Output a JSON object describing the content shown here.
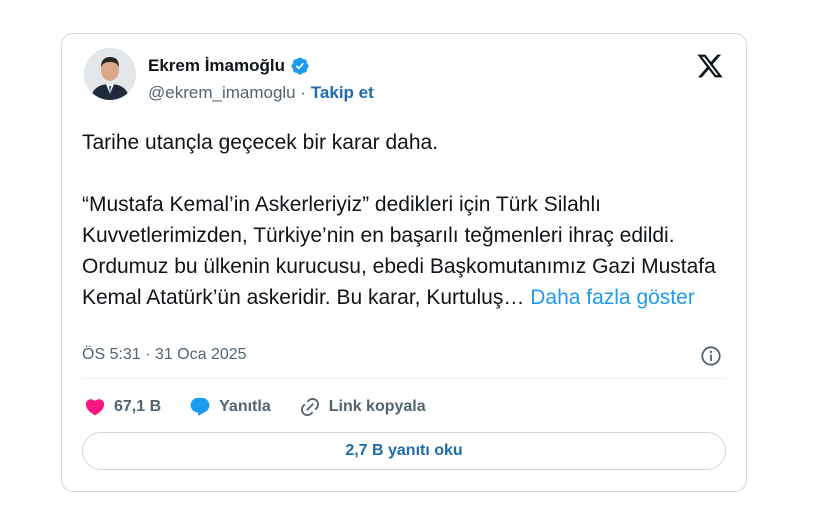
{
  "author": {
    "name": "Ekrem İmamoğlu",
    "handle": "@ekrem_imamoglu",
    "separator": "·",
    "follow_label": "Takip et"
  },
  "tweet": {
    "text": "Tarihe utançla geçecek bir karar daha.\n\n“Mustafa Kemal’in Askerleriyiz” dedikleri için Türk Silahlı Kuvvetlerimizden, Türkiye’nin en başarılı teğmenleri ihraç edildi. Ordumuz bu ülkenin kurucusu, ebedi Başkomutanımız Gazi Mustafa Kemal Atatürk’ün askeridir. Bu karar, Kurtuluş…",
    "show_more_label": "Daha fazla göster",
    "timestamp": "ÖS 5:31 · 31 Oca 2025"
  },
  "actions": {
    "like_count": "67,1 B",
    "reply_label": "Yanıtla",
    "copy_link_label": "Link kopyala",
    "read_replies_label": "2,7 B yanıtı oku"
  },
  "colors": {
    "accent": "#1d9bf0",
    "link_dark": "#1d6bb0",
    "heart": "#f91880",
    "muted": "#536471"
  },
  "icons": [
    "avatar",
    "verified-badge-icon",
    "x-logo-icon",
    "info-icon",
    "heart-icon",
    "reply-bubble-icon",
    "link-icon"
  ]
}
